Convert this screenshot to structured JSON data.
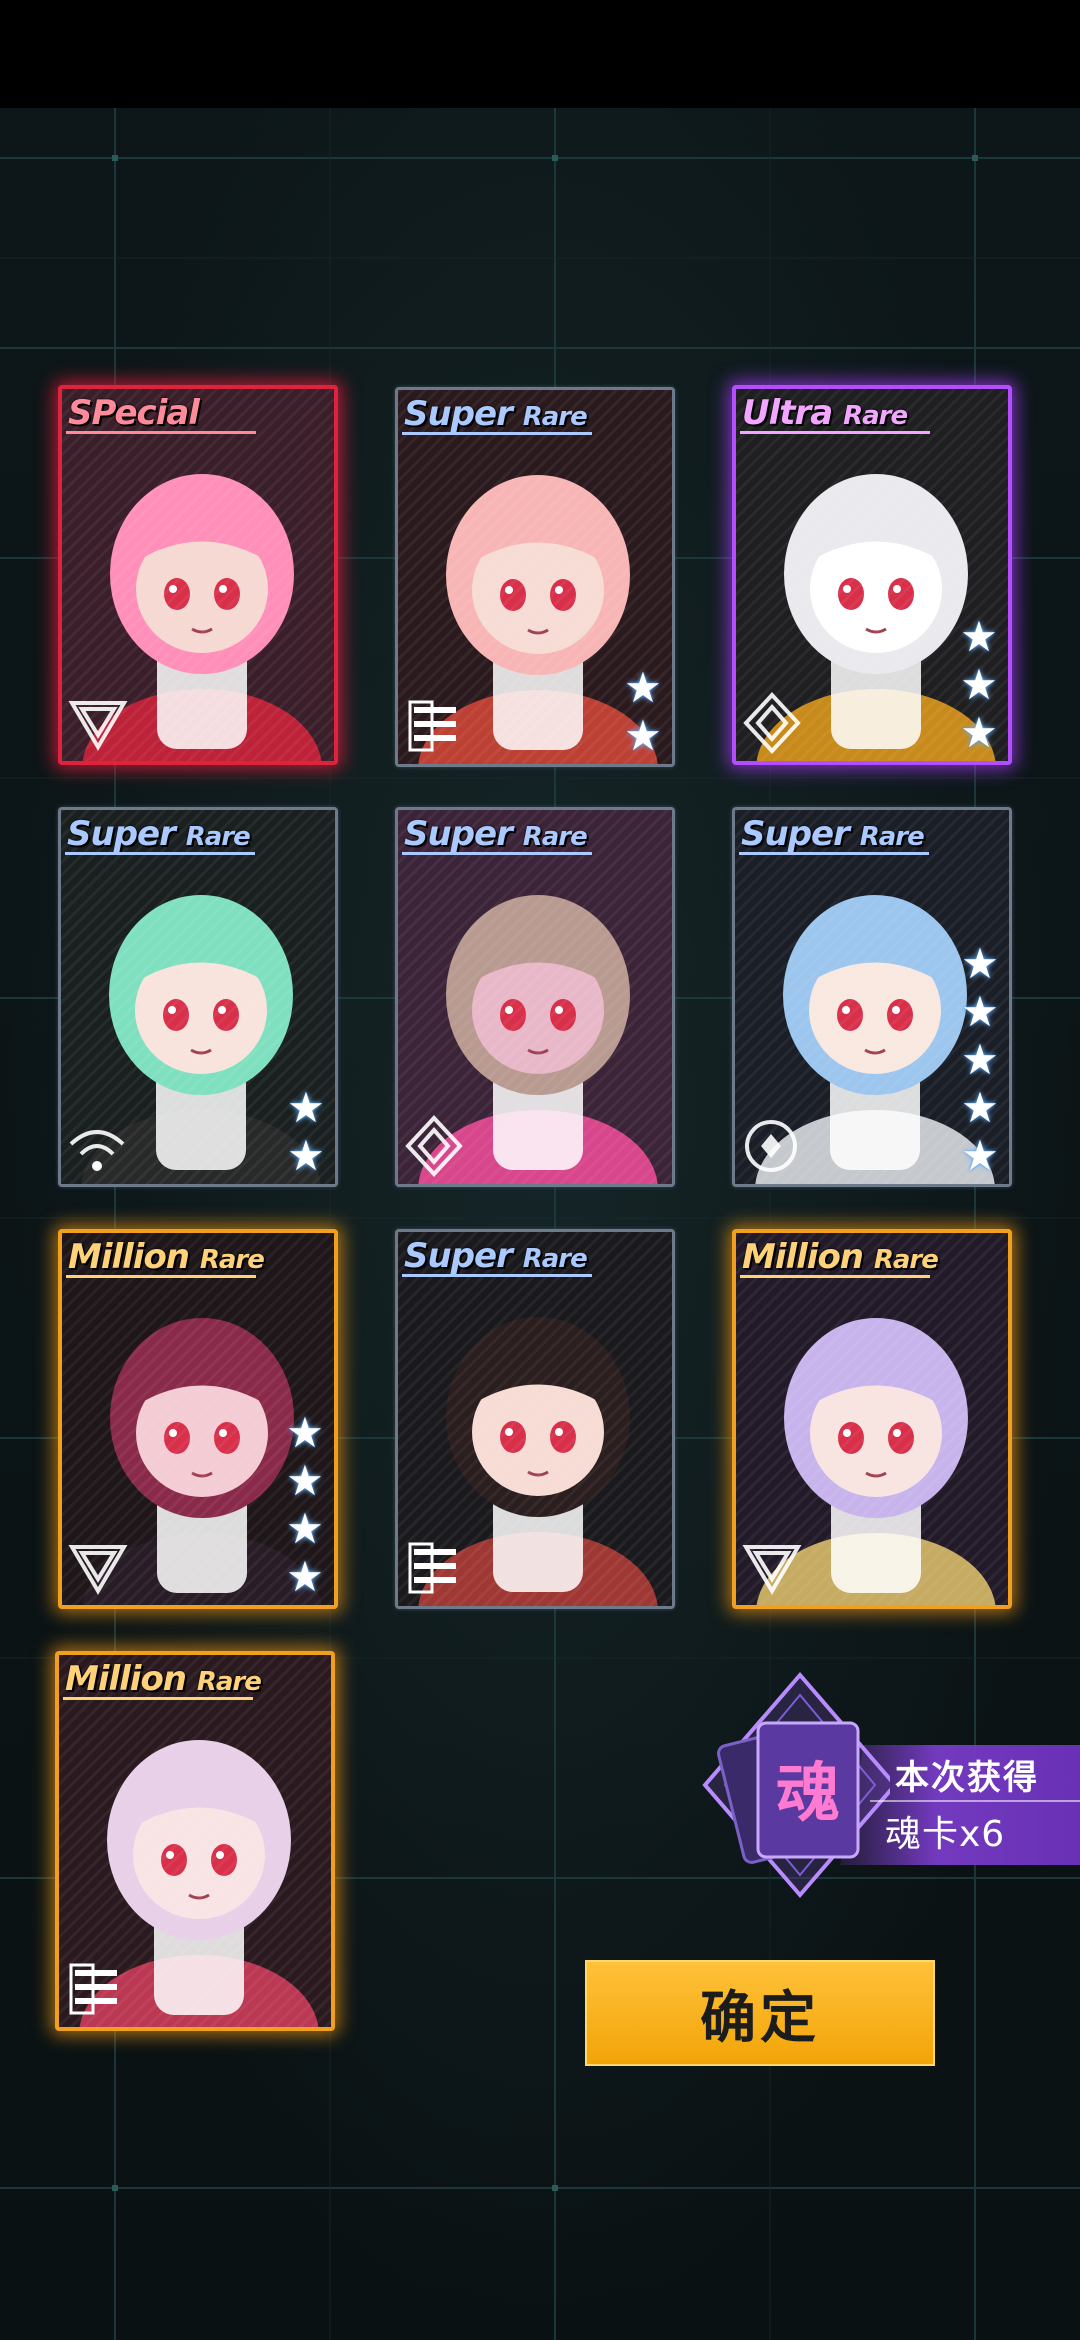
{
  "cards": [
    {
      "rarity_main": "SPecial",
      "rarity_sub": "",
      "rarity_color": "#ff8a9a",
      "frame": "special",
      "type_icon": "triangle-emblem-icon",
      "stars": 0
    },
    {
      "rarity_main": "Super",
      "rarity_sub": "Rare",
      "rarity_color": "#a9c9ff",
      "frame": "super",
      "type_icon": "stripes-emblem-icon",
      "stars": 2
    },
    {
      "rarity_main": "Ultra",
      "rarity_sub": "Rare",
      "rarity_color": "#f2a6ff",
      "frame": "ultra",
      "type_icon": "diamond-emblem-icon",
      "stars": 3
    },
    {
      "rarity_main": "Super",
      "rarity_sub": "Rare",
      "rarity_color": "#a9c9ff",
      "frame": "super",
      "type_icon": "signal-emblem-icon",
      "stars": 2
    },
    {
      "rarity_main": "Super",
      "rarity_sub": "Rare",
      "rarity_color": "#a9c9ff",
      "frame": "super",
      "type_icon": "diamond-emblem-icon",
      "stars": 0
    },
    {
      "rarity_main": "Super",
      "rarity_sub": "Rare",
      "rarity_color": "#a9c9ff",
      "frame": "super",
      "type_icon": "circle-emblem-icon",
      "stars": 5
    },
    {
      "rarity_main": "Million",
      "rarity_sub": "Rare",
      "rarity_color": "#ffd27a",
      "frame": "million",
      "type_icon": "triangle-emblem-icon",
      "stars": 4
    },
    {
      "rarity_main": "Super",
      "rarity_sub": "Rare",
      "rarity_color": "#a9c9ff",
      "frame": "super",
      "type_icon": "stripes-emblem-icon",
      "stars": 0
    },
    {
      "rarity_main": "Million",
      "rarity_sub": "Rare",
      "rarity_color": "#ffd27a",
      "frame": "million",
      "type_icon": "triangle-emblem-icon",
      "stars": 0
    },
    {
      "rarity_main": "Million",
      "rarity_sub": "Rare",
      "rarity_color": "#ffd27a",
      "frame": "million",
      "type_icon": "stripes-emblem-icon",
      "stars": 0
    }
  ],
  "reward": {
    "emblem_char": "魂",
    "title": "本次获得",
    "item": "魂卡x6"
  },
  "confirm_label": "确定"
}
